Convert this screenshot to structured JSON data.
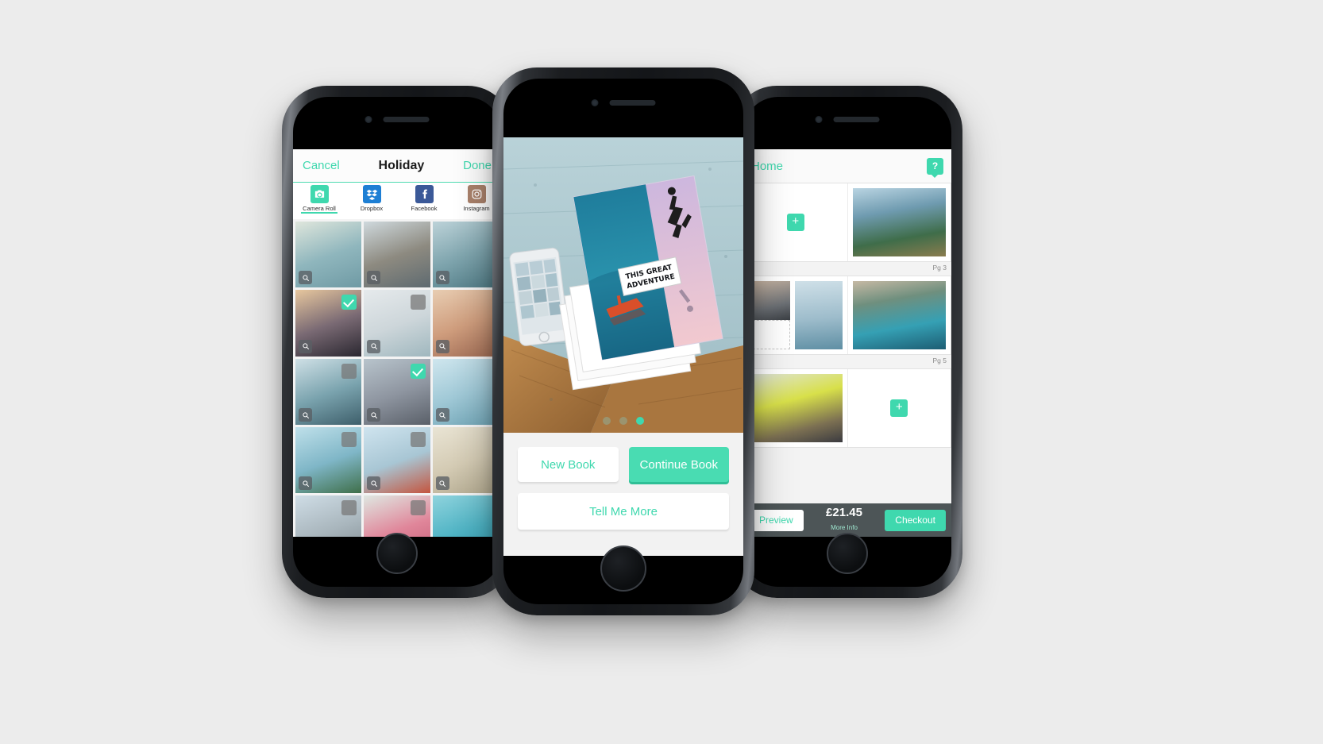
{
  "theme": {
    "accent": "#3fd8ae",
    "accent_dark": "#2fbf96",
    "bar_dark": "#4d5557",
    "page_bg": "#ececec"
  },
  "left_phone": {
    "nav": {
      "cancel_label": "Cancel",
      "title": "Holiday",
      "done_label": "Done"
    },
    "sources": [
      {
        "label": "Camera Roll",
        "icon": "camera-icon",
        "color": "#3fd8ae",
        "active": true
      },
      {
        "label": "Dropbox",
        "icon": "dropbox-icon",
        "color": "#1e7fd4",
        "active": false
      },
      {
        "label": "Facebook",
        "icon": "facebook-icon",
        "color": "#3b5998",
        "active": false
      },
      {
        "label": "Instagram",
        "icon": "instagram-icon",
        "color": "#a9816b",
        "active": false
      }
    ],
    "photos": [
      {
        "name": "beach-aerial",
        "selected": null,
        "zoom": true,
        "c1": "#dfe6dc",
        "c2": "#8fb6bd",
        "c3": "#6f9aa4"
      },
      {
        "name": "pier-walkway",
        "selected": null,
        "zoom": true,
        "c1": "#cfd9dd",
        "c2": "#8d8a80",
        "c3": "#5e6a70"
      },
      {
        "name": "coast-rocks",
        "selected": null,
        "zoom": true,
        "c1": "#bcd2d8",
        "c2": "#7ea4ad",
        "c3": "#4f7a84"
      },
      {
        "name": "city-sunset-figure",
        "selected": true,
        "zoom": true,
        "c1": "#e7c79e",
        "c2": "#7a6a74",
        "c3": "#2a2730"
      },
      {
        "name": "foggy-shore",
        "selected": false,
        "zoom": true,
        "c1": "#e6eaec",
        "c2": "#cdd6da",
        "c3": "#9fb7be"
      },
      {
        "name": "sunbather",
        "selected": null,
        "zoom": true,
        "c1": "#e8cdb2",
        "c2": "#cf9d7d",
        "c3": "#9e6a53"
      },
      {
        "name": "cliff-ocean",
        "selected": false,
        "zoom": true,
        "c1": "#cfe0e6",
        "c2": "#7aa3ae",
        "c3": "#3e5f6b"
      },
      {
        "name": "crowd-city",
        "selected": true,
        "zoom": true,
        "c1": "#b8c4cc",
        "c2": "#8e95a0",
        "c3": "#5a6069"
      },
      {
        "name": "seagull-flight",
        "selected": null,
        "zoom": true,
        "c1": "#cfe6ee",
        "c2": "#9fc8d6",
        "c3": "#6ea3b4"
      },
      {
        "name": "palm-trees",
        "selected": false,
        "zoom": true,
        "c1": "#bfe0ea",
        "c2": "#7fb6c7",
        "c3": "#3f6f4a"
      },
      {
        "name": "red-dress-field",
        "selected": false,
        "zoom": true,
        "c1": "#cfe4ef",
        "c2": "#a8c6d4",
        "c3": "#c4553f"
      },
      {
        "name": "dune-grass",
        "selected": null,
        "zoom": true,
        "c1": "#e9e4d4",
        "c2": "#d4cbb4",
        "c3": "#b0a78d"
      },
      {
        "name": "crane-building",
        "selected": false,
        "zoom": false,
        "c1": "#cfdde6",
        "c2": "#a9b6bd",
        "c3": "#7c878d"
      },
      {
        "name": "pink-blossom",
        "selected": false,
        "zoom": false,
        "c1": "#dfe8e2",
        "c2": "#e0869a",
        "c3": "#c25a74"
      },
      {
        "name": "turquoise-water",
        "selected": null,
        "zoom": false,
        "c1": "#8fd3dd",
        "c2": "#4eb3c4",
        "c3": "#2b8fa3"
      }
    ]
  },
  "center_phone": {
    "hero": {
      "name": "photo-book-hero",
      "book_title_line1": "THIS GREAT",
      "book_title_line2": "ADVENTURE"
    },
    "carousel": {
      "total": 3,
      "active_index": 2
    },
    "buttons": {
      "new_book": "New Book",
      "continue_book": "Continue Book",
      "tell_me_more": "Tell Me More"
    }
  },
  "right_phone": {
    "nav": {
      "title": "Home",
      "help_label": "?"
    },
    "spreads": [
      {
        "page_label": "Pg 3",
        "left": {
          "type": "add",
          "plus": "+"
        },
        "right": {
          "type": "photo",
          "name": "coastal-town-aerial"
        }
      },
      {
        "page_label": "Pg 5",
        "left": {
          "type": "collage",
          "name": "camera-hands-and-swimmer"
        },
        "right": {
          "type": "photo",
          "name": "big-sur-cove"
        }
      },
      {
        "page_label": "",
        "left": {
          "type": "photo",
          "name": "yellow-flowers-woman"
        },
        "right": {
          "type": "add",
          "plus": "+"
        }
      }
    ],
    "bottom_bar": {
      "preview_label": "Preview",
      "price": "£21.45",
      "more_info": "More Info",
      "checkout_label": "Checkout"
    }
  }
}
